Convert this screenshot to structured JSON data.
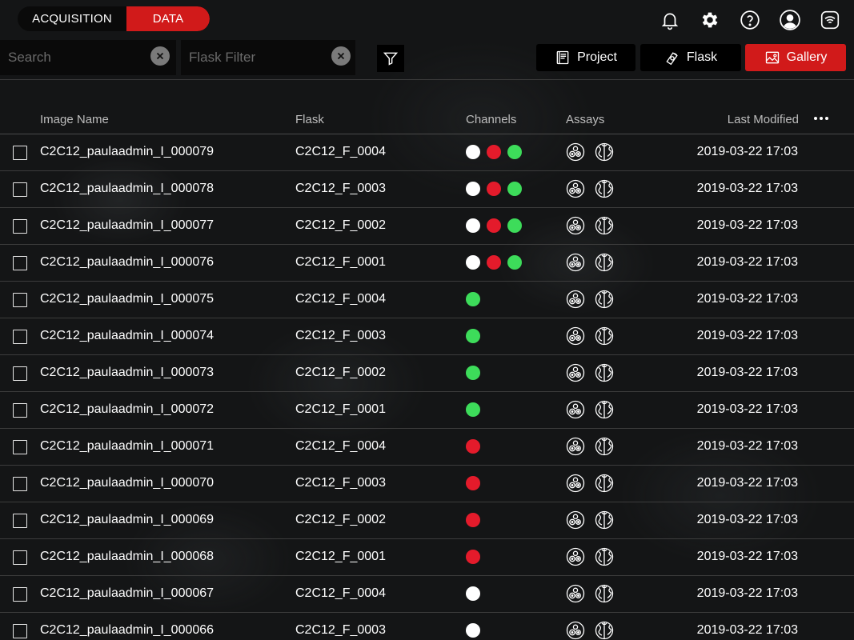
{
  "mode_tabs": {
    "acquisition": "ACQUISITION",
    "data": "DATA"
  },
  "search": {
    "placeholder": "Search",
    "value": ""
  },
  "flask_filter": {
    "placeholder": "Flask Filter",
    "value": ""
  },
  "views": {
    "project": "Project",
    "flask": "Flask",
    "gallery": "Gallery",
    "active": "gallery"
  },
  "colors": {
    "accent": "#d11a1a",
    "white": "#ffffff",
    "red": "#e41b2b",
    "green": "#3ddc5a"
  },
  "icons": [
    "bell-icon",
    "gear-icon",
    "help-icon",
    "user-icon",
    "wifi-icon",
    "filter-icon",
    "project-icon",
    "flask-icon",
    "gallery-icon",
    "clear-icon",
    "more-icon",
    "assay-cells-icon",
    "assay-globe-icon"
  ],
  "columns": {
    "name": "Image Name",
    "flask": "Flask",
    "channels": "Channels",
    "assays": "Assays",
    "modified": "Last Modified"
  },
  "rows": [
    {
      "name": "C2C12_paulaadmin_I_000079",
      "flask": "C2C12_F_0004",
      "channels": [
        "white",
        "red",
        "green"
      ],
      "modified": "2019-03-22 17:03"
    },
    {
      "name": "C2C12_paulaadmin_I_000078",
      "flask": "C2C12_F_0003",
      "channels": [
        "white",
        "red",
        "green"
      ],
      "modified": "2019-03-22 17:03"
    },
    {
      "name": "C2C12_paulaadmin_I_000077",
      "flask": "C2C12_F_0002",
      "channels": [
        "white",
        "red",
        "green"
      ],
      "modified": "2019-03-22 17:03"
    },
    {
      "name": "C2C12_paulaadmin_I_000076",
      "flask": "C2C12_F_0001",
      "channels": [
        "white",
        "red",
        "green"
      ],
      "modified": "2019-03-22 17:03"
    },
    {
      "name": "C2C12_paulaadmin_I_000075",
      "flask": "C2C12_F_0004",
      "channels": [
        "green"
      ],
      "modified": "2019-03-22 17:03"
    },
    {
      "name": "C2C12_paulaadmin_I_000074",
      "flask": "C2C12_F_0003",
      "channels": [
        "green"
      ],
      "modified": "2019-03-22 17:03"
    },
    {
      "name": "C2C12_paulaadmin_I_000073",
      "flask": "C2C12_F_0002",
      "channels": [
        "green"
      ],
      "modified": "2019-03-22 17:03"
    },
    {
      "name": "C2C12_paulaadmin_I_000072",
      "flask": "C2C12_F_0001",
      "channels": [
        "green"
      ],
      "modified": "2019-03-22 17:03"
    },
    {
      "name": "C2C12_paulaadmin_I_000071",
      "flask": "C2C12_F_0004",
      "channels": [
        "red"
      ],
      "modified": "2019-03-22 17:03"
    },
    {
      "name": "C2C12_paulaadmin_I_000070",
      "flask": "C2C12_F_0003",
      "channels": [
        "red"
      ],
      "modified": "2019-03-22 17:03"
    },
    {
      "name": "C2C12_paulaadmin_I_000069",
      "flask": "C2C12_F_0002",
      "channels": [
        "red"
      ],
      "modified": "2019-03-22 17:03"
    },
    {
      "name": "C2C12_paulaadmin_I_000068",
      "flask": "C2C12_F_0001",
      "channels": [
        "red"
      ],
      "modified": "2019-03-22 17:03"
    },
    {
      "name": "C2C12_paulaadmin_I_000067",
      "flask": "C2C12_F_0004",
      "channels": [
        "white"
      ],
      "modified": "2019-03-22 17:03"
    },
    {
      "name": "C2C12_paulaadmin_I_000066",
      "flask": "C2C12_F_0003",
      "channels": [
        "white"
      ],
      "modified": "2019-03-22 17:03"
    }
  ]
}
